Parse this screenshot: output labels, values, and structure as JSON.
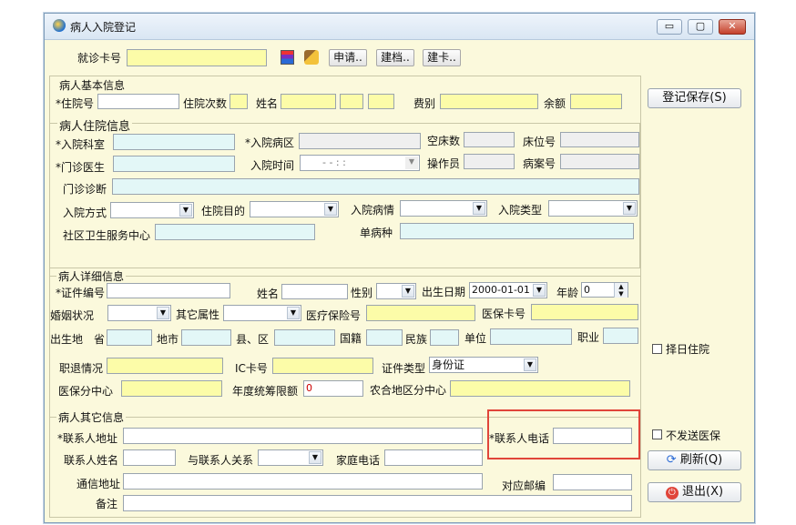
{
  "window": {
    "title": "病人入院登记",
    "minimize": "▭",
    "restore": "▢",
    "close": "✕"
  },
  "top": {
    "card_label": "就诊卡号",
    "btn_apply": "申请..",
    "btn_file": "建档..",
    "btn_card": "建卡.."
  },
  "basic": {
    "title": "病人基本信息",
    "admit_no": "*住院号",
    "admit_times": "住院次数",
    "name": "姓名",
    "fee_type": "费别",
    "balance": "余额"
  },
  "admit": {
    "title": "病人住院信息",
    "dept": "*入院科室",
    "ward": "*入院病区",
    "empty_beds": "空床数",
    "bed_no": "床位号",
    "clinic_doctor": "*门诊医生",
    "admit_time": "入院时间",
    "admit_time_value": "- -  : :",
    "operator": "操作员",
    "case_no": "病案号",
    "clinic_diag": "门诊诊断",
    "admit_mode": "入院方式",
    "purpose": "住院目的",
    "condition": "入院病情",
    "admit_type": "入院类型",
    "community": "社区卫生服务中心",
    "single_disease": "单病种"
  },
  "detail": {
    "title": "病人详细信息",
    "id_no": "*证件编号",
    "name": "姓名",
    "sex": "性别",
    "birth_label": "出生日期",
    "birth_value": "2000-01-01",
    "age_label": "年龄",
    "age_value": "0",
    "marital": "婚姻状况",
    "other_attr": "其它属性",
    "insurance_no": "医疗保险号",
    "insurance_card": "医保卡号",
    "birthplace": "出生地",
    "province": "省",
    "city": "地市",
    "county": "县、区",
    "nationality": "国籍",
    "ethnicity": "民族",
    "unit": "单位",
    "job": "职业",
    "retire": "职退情况",
    "ic_card": "IC卡号",
    "id_type_label": "证件类型",
    "id_type_value": "身份证",
    "ins_center": "医保分中心",
    "annual_limit_label": "年度统筹限额",
    "annual_limit_value": "0",
    "coop_center": "农合地区分中心"
  },
  "other": {
    "title": "病人其它信息",
    "contact_addr": "*联系人地址",
    "contact_phone": "*联系人电话",
    "contact_name": "联系人姓名",
    "relation": "与联系人关系",
    "home_phone": "家庭电话",
    "mail_addr": "通信地址",
    "postcode": "对应邮编",
    "remark": "备注"
  },
  "side": {
    "save": "登记保存(S)",
    "select_day": "择日住院",
    "no_insurance": "不发送医保",
    "refresh": "刷新(Q)",
    "exit": "退出(X)"
  },
  "colors": {
    "yellow_field": "#fcfca8",
    "cyan_field": "#e3f7f7",
    "highlight": "#e0453a"
  }
}
